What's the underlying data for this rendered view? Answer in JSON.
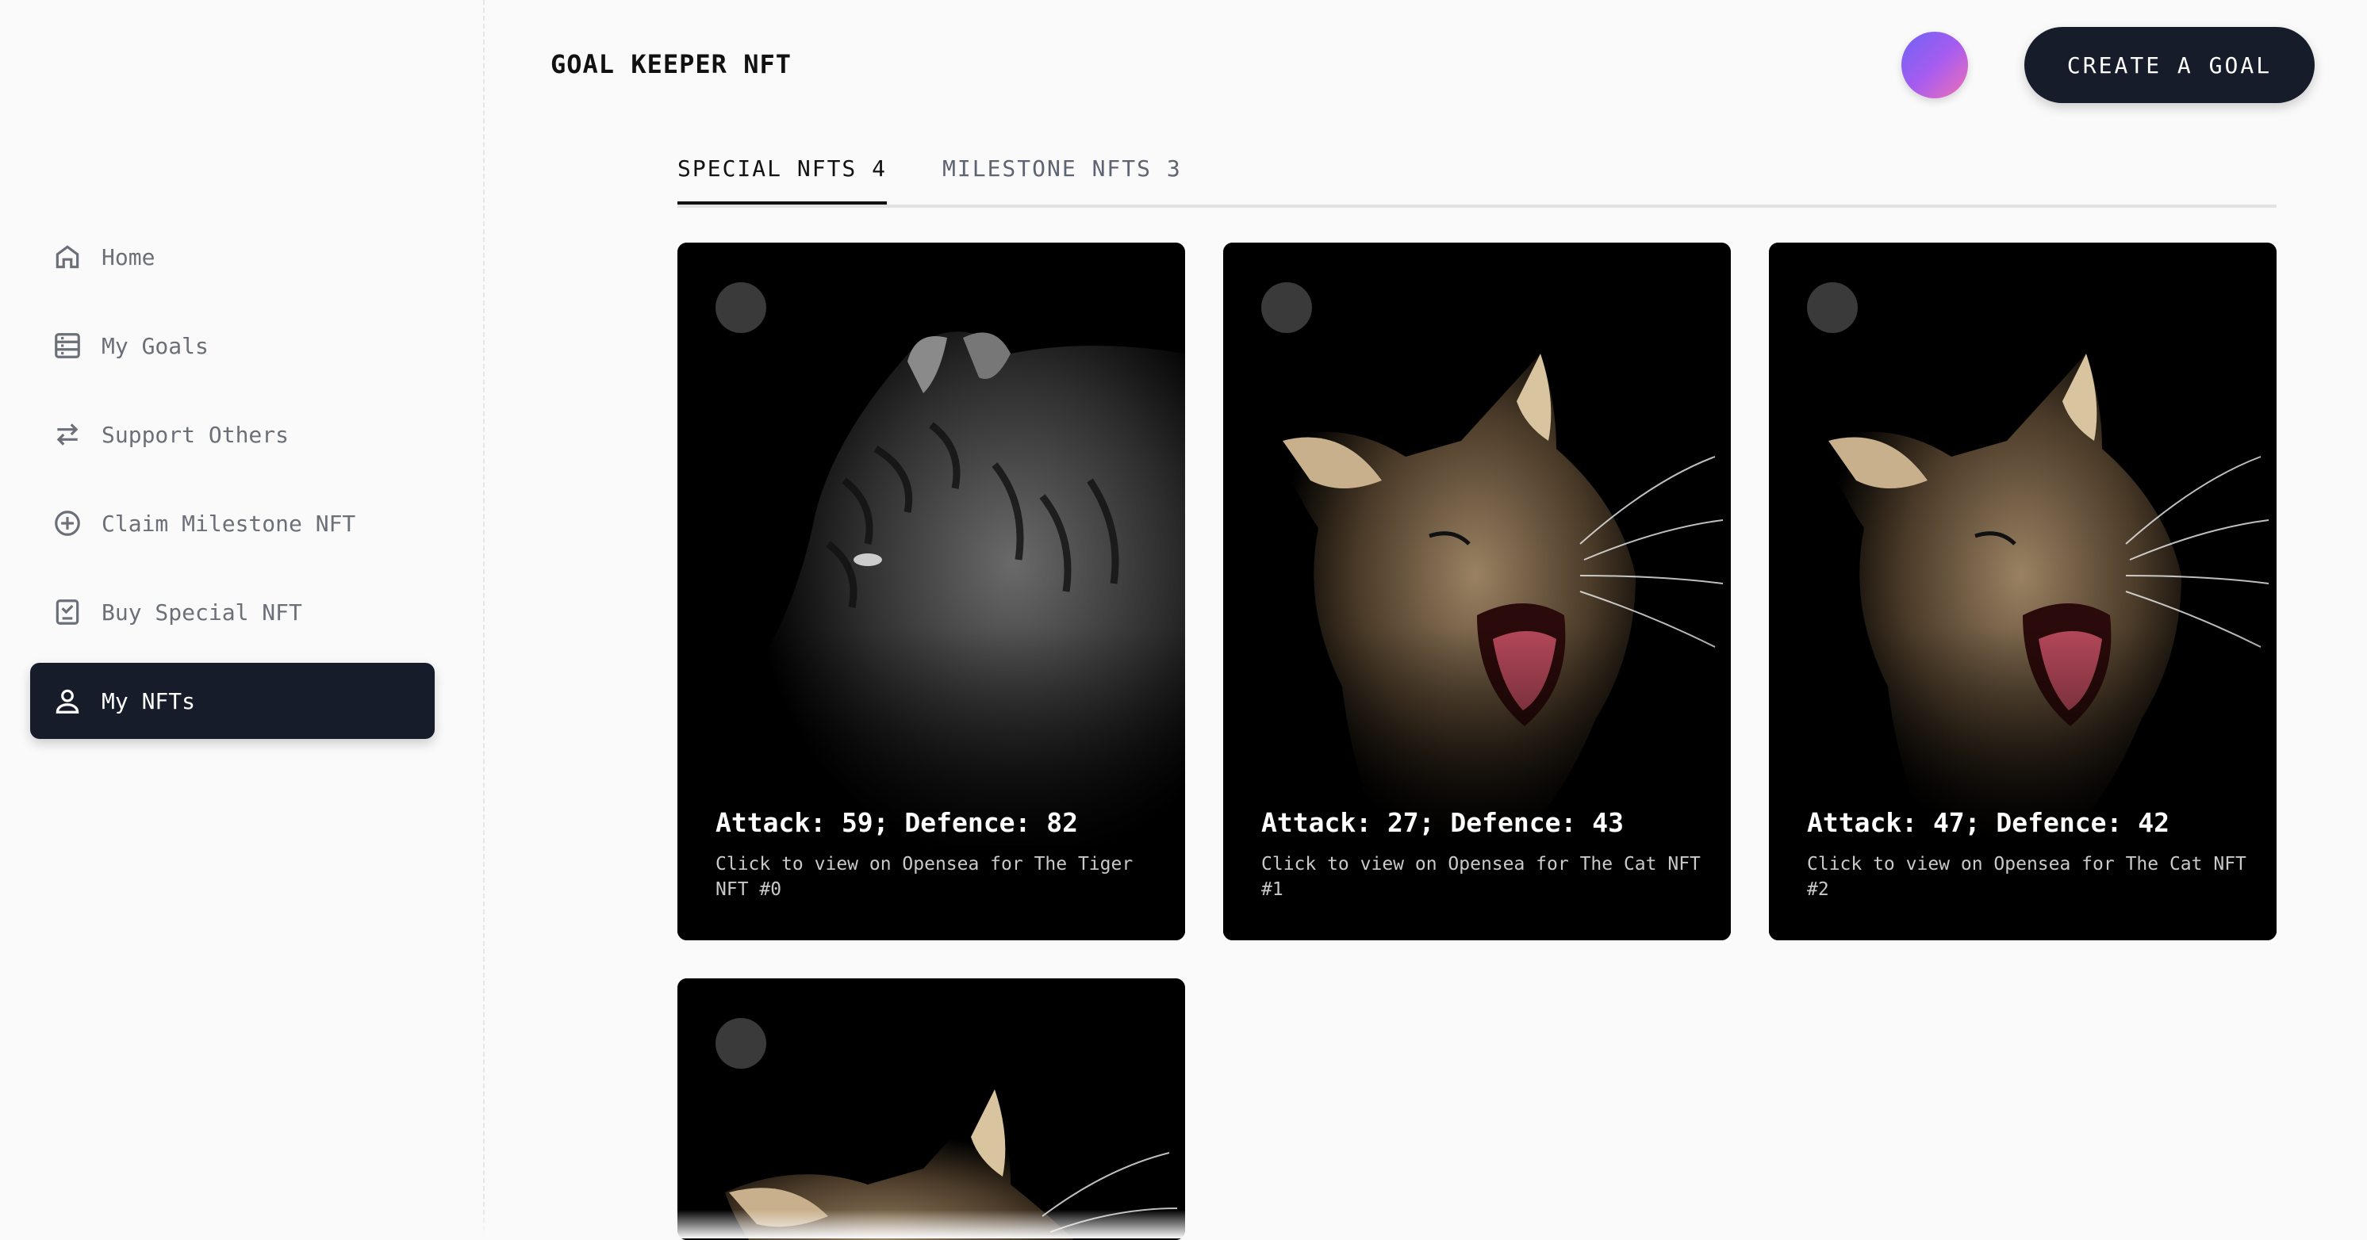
{
  "app": {
    "brand": "GOAL KEEPER NFT",
    "create_label": "CREATE A GOAL"
  },
  "sidebar": {
    "items": [
      {
        "label": "Home",
        "icon": "home-icon",
        "active": false
      },
      {
        "label": "My Goals",
        "icon": "goals-icon",
        "active": false
      },
      {
        "label": "Support Others",
        "icon": "swap-arrows-icon",
        "active": false
      },
      {
        "label": "Claim Milestone NFT",
        "icon": "plus-circle-icon",
        "active": false
      },
      {
        "label": "Buy Special NFT",
        "icon": "checkbox-icon",
        "active": false
      },
      {
        "label": "My NFTs",
        "icon": "user-icon",
        "active": true
      }
    ]
  },
  "tabs": [
    {
      "label": "SPECIAL NFTS 4",
      "active": true
    },
    {
      "label": "MILESTONE NFTS 3",
      "active": false
    }
  ],
  "cards": [
    {
      "stats": "Attack: 59; Defence: 82",
      "desc": "Click to view on Opensea for The Tiger NFT #0",
      "image": "tiger"
    },
    {
      "stats": "Attack: 27; Defence: 43",
      "desc": "Click to view on Opensea for The Cat NFT #1",
      "image": "cat"
    },
    {
      "stats": "Attack: 47; Defence: 42",
      "desc": "Click to view on Opensea for The Cat NFT #2",
      "image": "cat"
    },
    {
      "stats": "",
      "desc": "",
      "image": "cat"
    }
  ],
  "colors": {
    "dark": "#171c2b",
    "bg": "#fafafa",
    "muted": "#6b6f78"
  }
}
